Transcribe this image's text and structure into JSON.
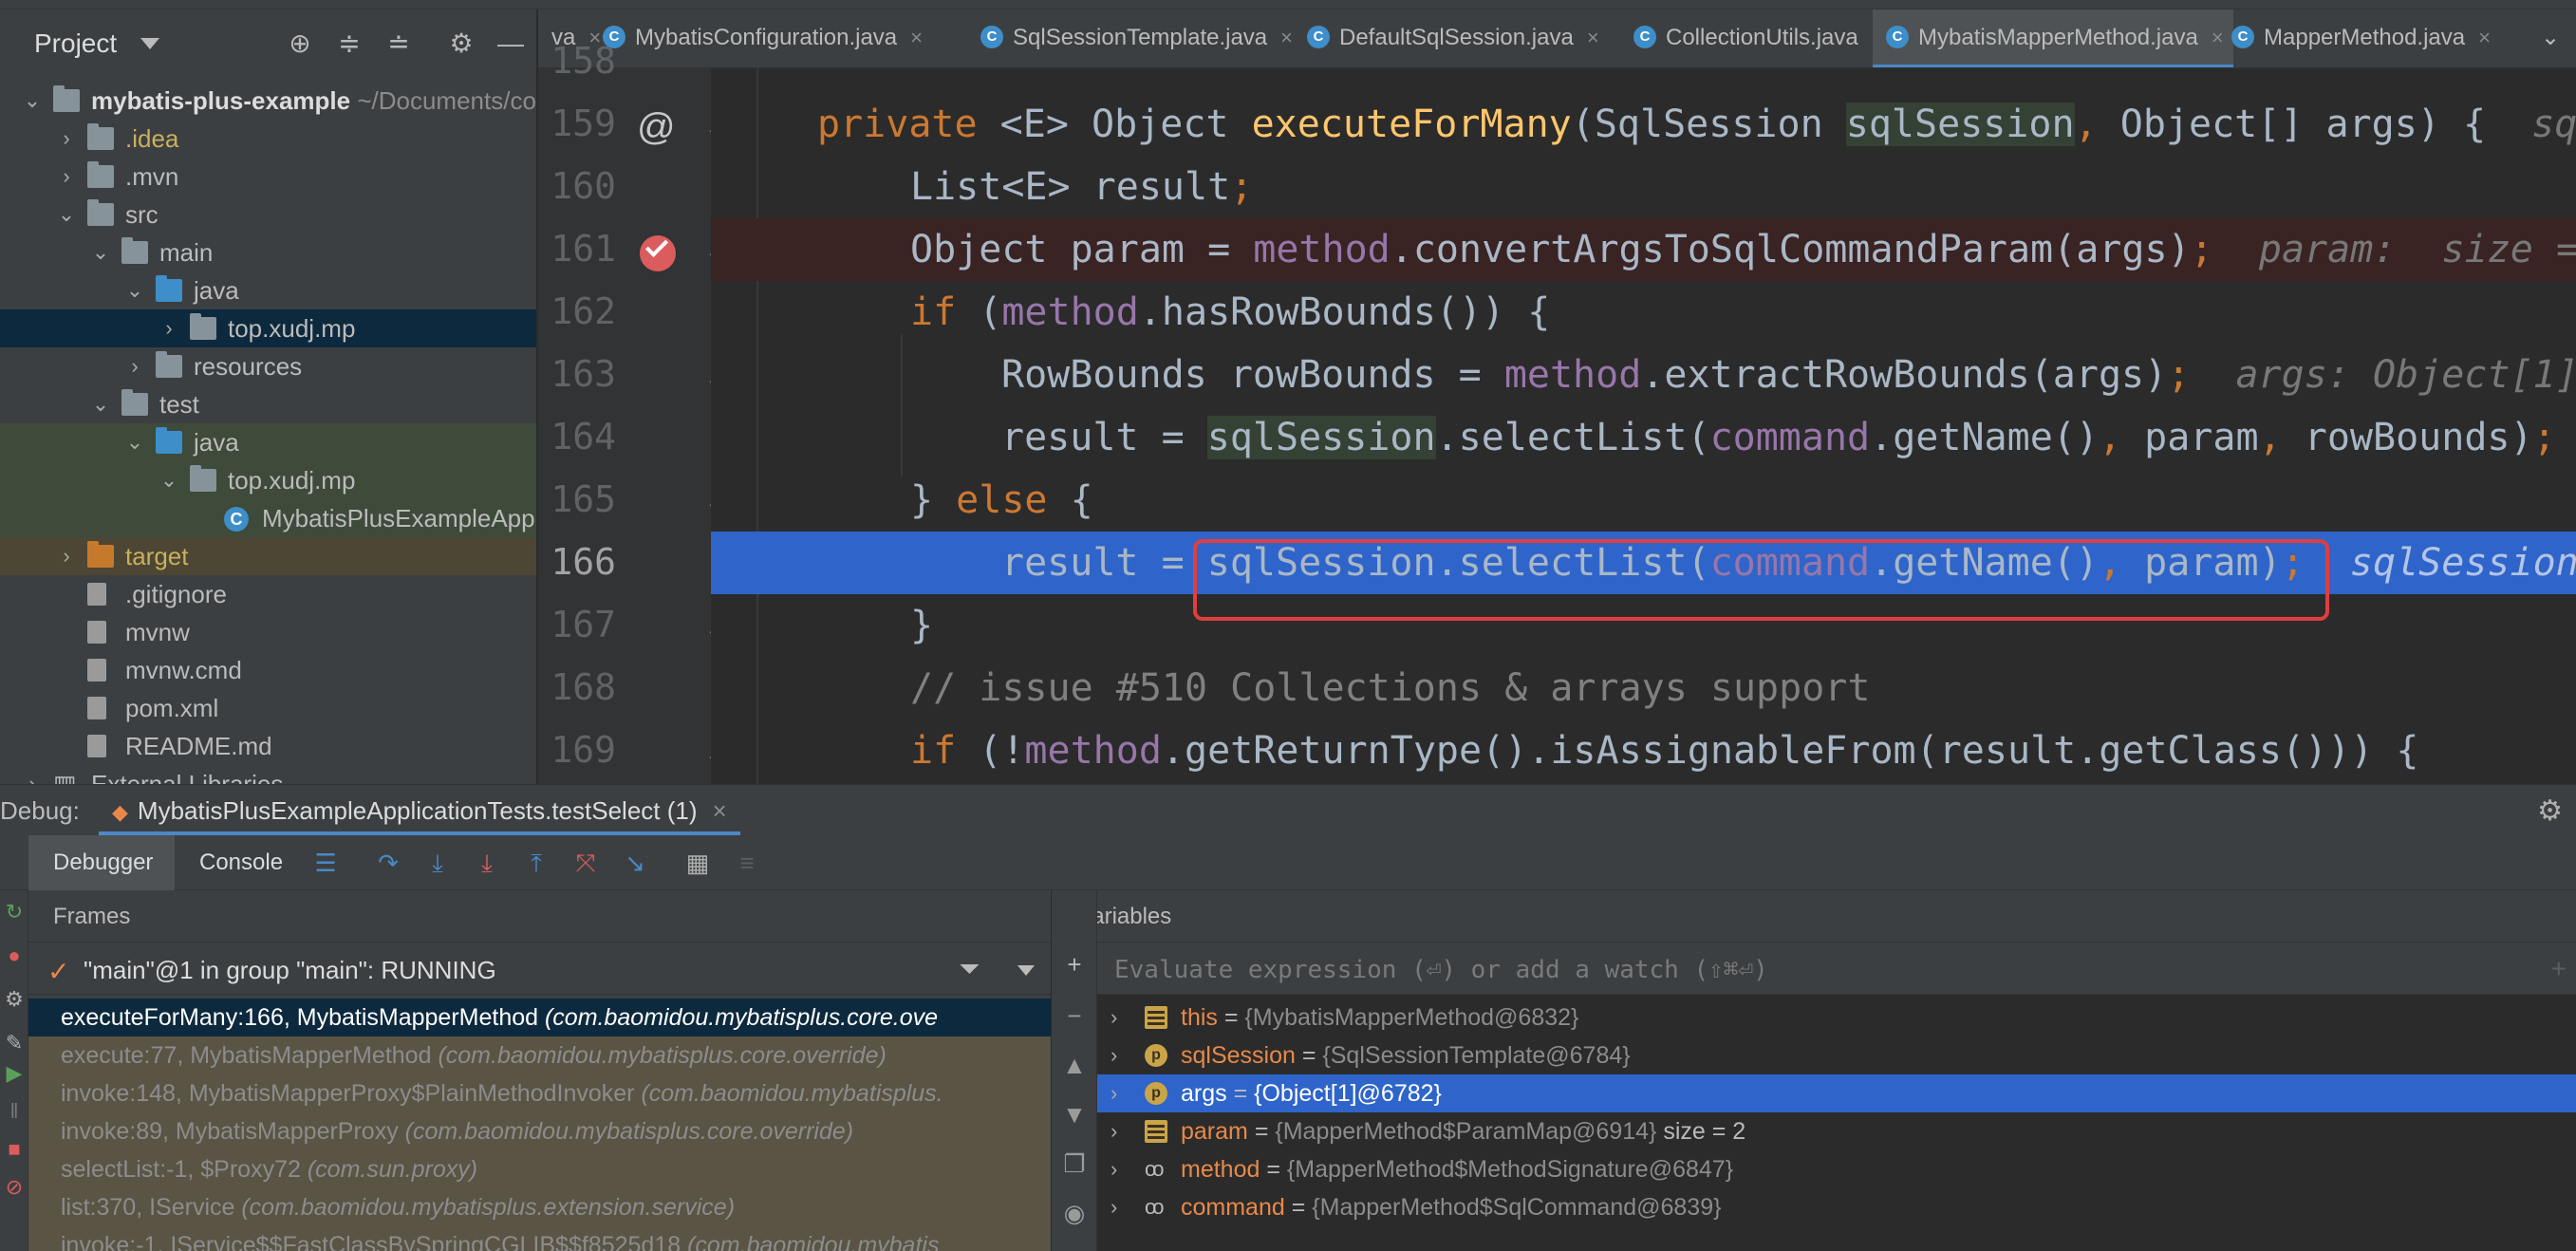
{
  "project_panel": {
    "title": "Project",
    "tree": [
      {
        "label": "mybatis-plus-example",
        "suffix": " ~/Documents/co",
        "chevron": "⌄",
        "icon": "folder",
        "indent": 0,
        "bold": true
      },
      {
        "label": ".idea",
        "chevron": "›",
        "icon": "folder",
        "indent": 1,
        "color": "#c9b05a"
      },
      {
        "label": ".mvn",
        "chevron": "›",
        "icon": "folder",
        "indent": 1
      },
      {
        "label": "src",
        "chevron": "⌄",
        "icon": "folder",
        "indent": 1
      },
      {
        "label": "main",
        "chevron": "⌄",
        "icon": "folder",
        "indent": 2
      },
      {
        "label": "java",
        "chevron": "⌄",
        "icon": "folder-blue",
        "indent": 3
      },
      {
        "label": "top.xudj.mp",
        "chevron": "›",
        "icon": "package",
        "indent": 4,
        "selected": true
      },
      {
        "label": "resources",
        "chevron": "›",
        "icon": "folder",
        "indent": 3
      },
      {
        "label": "test",
        "chevron": "⌄",
        "icon": "folder",
        "indent": 2
      },
      {
        "label": "java",
        "chevron": "⌄",
        "icon": "folder-green",
        "indent": 3,
        "green_bg": true
      },
      {
        "label": "top.xudj.mp",
        "chevron": "⌄",
        "icon": "package",
        "indent": 4,
        "green_bg": true
      },
      {
        "label": "MybatisPlusExampleApplic",
        "chevron": "",
        "icon": "java-class",
        "indent": 5,
        "green_bg": true
      },
      {
        "label": "target",
        "chevron": "›",
        "icon": "folder-orange",
        "indent": 1,
        "color": "#c9b05a",
        "orange_bg": true
      },
      {
        "label": ".gitignore",
        "chevron": "",
        "icon": "file",
        "indent": 1
      },
      {
        "label": "mvnw",
        "chevron": "",
        "icon": "file",
        "indent": 1
      },
      {
        "label": "mvnw.cmd",
        "chevron": "",
        "icon": "file",
        "indent": 1
      },
      {
        "label": "pom.xml",
        "chevron": "",
        "icon": "file",
        "indent": 1
      },
      {
        "label": "README.md",
        "chevron": "",
        "icon": "file",
        "indent": 1
      },
      {
        "label": "External Libraries",
        "chevron": "›",
        "icon": "library",
        "indent": 0
      }
    ]
  },
  "editor_tabs": [
    {
      "label": "va",
      "partial": true
    },
    {
      "label": "MybatisConfiguration.java"
    },
    {
      "label": "SqlSessionTemplate.java"
    },
    {
      "label": "DefaultSqlSession.java"
    },
    {
      "label": "CollectionUtils.java"
    },
    {
      "label": "MybatisMapperMethod.java",
      "active": true
    },
    {
      "label": "MapperMethod.java"
    }
  ],
  "tab_close_glyph": "×",
  "editor": {
    "line_numbers": [
      "158",
      "159",
      "160",
      "161",
      "162",
      "163",
      "164",
      "165",
      "166",
      "167",
      "168",
      "169"
    ],
    "current_line": "166",
    "lines": [
      "private <E> Object executeForMany(SqlSession sqlSession, Object[] args) {",
      "List<E> result;",
      "Object param = method.convertArgsToSqlCommandParam(args);",
      "if (method.hasRowBounds()) {",
      "RowBounds rowBounds = method.extractRowBounds(args);",
      "result = sqlSession.selectList(command.getName(), param, rowBounds);",
      "} else {",
      "result = sqlSession.selectList(command.getName(), param);",
      "}",
      "// issue #510 Collections & arrays support",
      "if (!method.getReturnType().isAssignableFrom(result.getClass())) {"
    ],
    "hints": {
      "line159": "sq",
      "line161": "param:  size =",
      "line163": "args: Object[1]",
      "line166": "sqlSession"
    },
    "gutter_marks": {
      "at": "@"
    }
  },
  "debug": {
    "label": "Debug:",
    "session": "MybatisPlusExampleApplicationTests.testSelect (1)",
    "tabs": {
      "debugger": "Debugger",
      "console": "Console"
    },
    "frames": {
      "title": "Frames",
      "thread": "\"main\"@1 in group \"main\": RUNNING",
      "rows": [
        {
          "method": "executeForMany:166, MybatisMapperMethod ",
          "pkg": "(com.baomidou.mybatisplus.core.ove",
          "selected": true
        },
        {
          "method": "execute:77, MybatisMapperMethod ",
          "pkg": "(com.baomidou.mybatisplus.core.override)"
        },
        {
          "method": "invoke:148, MybatisMapperProxy$PlainMethodInvoker ",
          "pkg": "(com.baomidou.mybatisplus."
        },
        {
          "method": "invoke:89, MybatisMapperProxy ",
          "pkg": "(com.baomidou.mybatisplus.core.override)"
        },
        {
          "method": "selectList:-1, $Proxy72 ",
          "pkg": "(com.sun.proxy)"
        },
        {
          "method": "list:370, IService ",
          "pkg": "(com.baomidou.mybatisplus.extension.service)"
        },
        {
          "method": "invoke:-1, IService$$FastClassBySpringCGLIB$$f8525d18 ",
          "pkg": "(com.baomidou.mybatis"
        }
      ]
    },
    "variables": {
      "title": "Variables",
      "eval_placeholder": "Evaluate expression (⏎) or add a watch (⇧⌘⏎)",
      "rows": [
        {
          "name": "this",
          "value": "{MybatisMapperMethod@6832}",
          "icon": "field"
        },
        {
          "name": "sqlSession",
          "value": "{SqlSessionTemplate@6784}",
          "icon": "param"
        },
        {
          "name": "args",
          "value": "{Object[1]@6782}",
          "icon": "param",
          "selected": true
        },
        {
          "name": "param",
          "value": "{MapperMethod$ParamMap@6914}",
          "extra": "  size = 2",
          "icon": "field"
        },
        {
          "name": "method",
          "value": "{MapperMethod$MethodSignature@6847}",
          "icon": "watch"
        },
        {
          "name": "command",
          "value": "{MapperMethod$SqlCommand@6839}",
          "icon": "watch"
        }
      ],
      "equals": " = "
    }
  },
  "colors": {
    "keyword": "#cc7832",
    "function": "#ffc66d",
    "field": "#9876aa",
    "comment": "#808080",
    "execution_line": "#2f65ca",
    "breakpoint": "#db5c5c",
    "highlight_box": "#e03e3e"
  },
  "icons": [
    "locate-icon",
    "expand-all-icon",
    "collapse-all-icon",
    "gear-icon",
    "minimize-icon",
    "filter-icon",
    "step-over-icon",
    "step-into-icon",
    "force-step-into-icon",
    "step-out-icon",
    "drop-frame-icon",
    "run-to-cursor-icon",
    "evaluate-icon",
    "add-watch-icon"
  ]
}
